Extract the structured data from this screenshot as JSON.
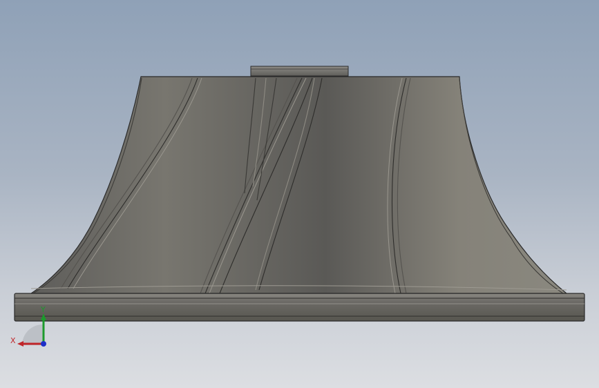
{
  "viewport": {
    "background_top": "#8fa1b7",
    "background_bottom": "#dcdee2"
  },
  "model": {
    "name": "impeller",
    "body_color": "#6e6c68",
    "edge_color": "#2a2a2a"
  },
  "triad": {
    "x_label": "X",
    "y_label": "Y",
    "x_color": "#c0262a",
    "y_color": "#1c9a2c",
    "z_color": "#1d2fc8"
  }
}
